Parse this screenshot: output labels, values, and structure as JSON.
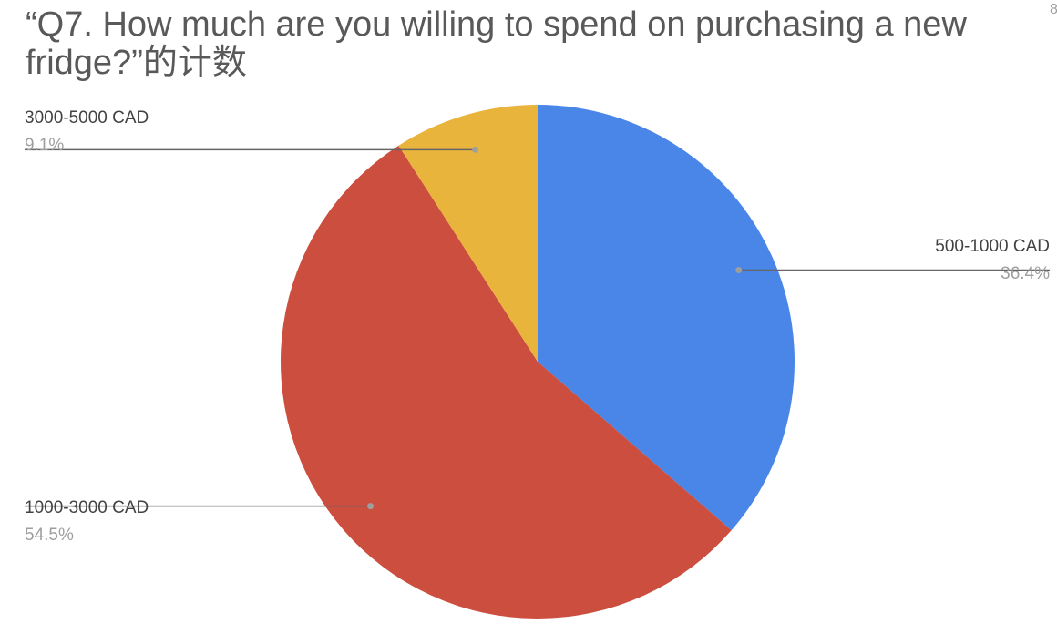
{
  "chart_data": {
    "type": "pie",
    "title": "“Q7. How much are you willing to spend on purchasing a new fridge?”的计数",
    "slices": [
      {
        "label": "500-1000 CAD",
        "value": 36.4,
        "pct_label": "36.4%",
        "color": "#4a86e8"
      },
      {
        "label": "1000-3000 CAD",
        "value": 54.5,
        "pct_label": "54.5%",
        "color": "#cc4e3f"
      },
      {
        "label": "3000-5000 CAD",
        "value": 9.1,
        "pct_label": "9.1%",
        "color": "#e9b43c"
      }
    ],
    "start_angle": "12 o'clock",
    "direction": "clockwise",
    "legend": "none",
    "label_style": "outside callouts"
  },
  "edge_mark": "8"
}
